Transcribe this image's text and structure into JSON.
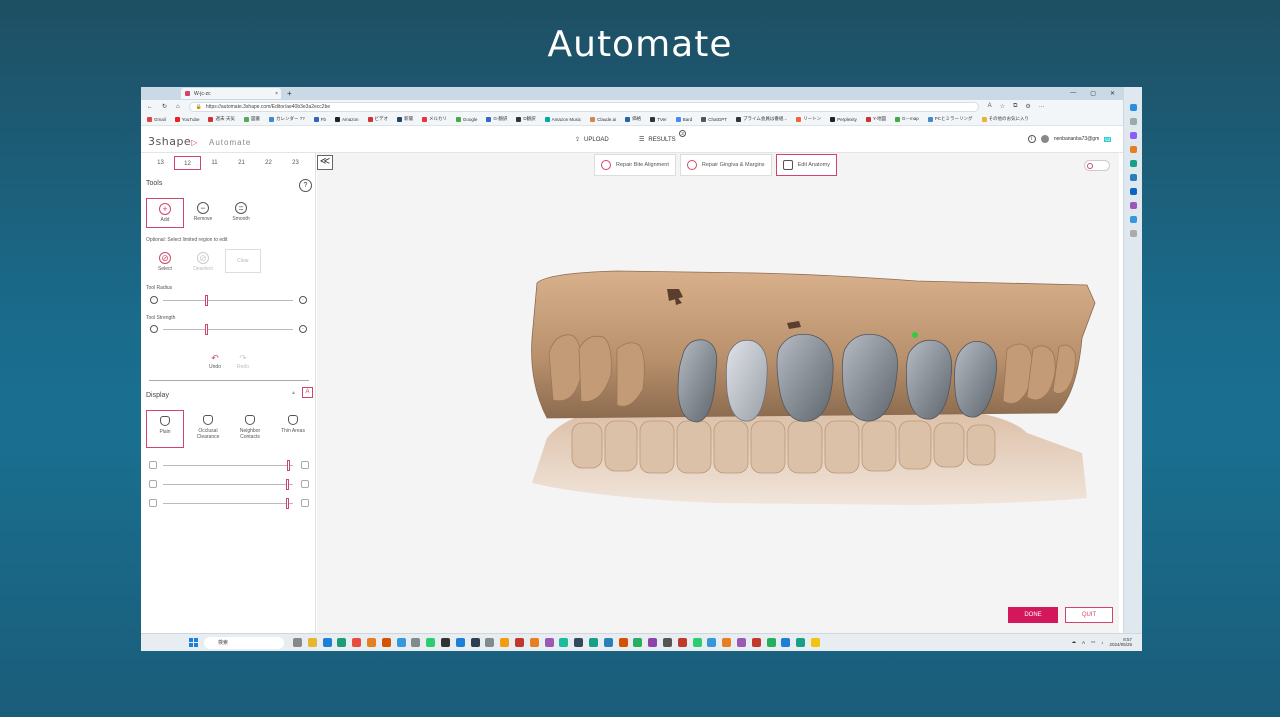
{
  "slide": {
    "title": "Automate"
  },
  "browser": {
    "tab_title": "W-jc-zc",
    "tab_close": "×",
    "new_tab": "+",
    "url": "https://automate.3shape.com/Editor/ae40b3e3a2ecc2be",
    "window_buttons": [
      "—",
      "▢",
      "✕"
    ],
    "nav": [
      "←",
      "↻",
      "⌂"
    ],
    "bookmarks": [
      "Gmail",
      "YouTube",
      "週末·天気",
      "図書",
      "カレンダー ??",
      "Fb",
      "Amazon",
      "ビデオ",
      "新聞",
      "メルカリ",
      "Google",
      "G-翻訳",
      "D翻訳",
      "Amazon Music",
      "Claude.ai",
      "価格",
      "TVer",
      "Bard",
      "ChatGPT",
      "プライム会員は番組...",
      "リートン",
      "Perplexity",
      "Y-地図",
      "G－map",
      "PCとミラーリング"
    ],
    "bookmarks_more": "その他のお気に入り"
  },
  "app": {
    "logo": "3shape",
    "logo_mark": "▷",
    "product": "Automate",
    "upload": "UPLOAD",
    "results": "RESULTS",
    "results_count": "3",
    "user": "nenbananba73@gm",
    "user_badge": "tid",
    "info_icon": "i"
  },
  "teeth_tabs": [
    "13",
    "12",
    "11",
    "21",
    "22",
    "23"
  ],
  "active_tooth": "12",
  "tools": {
    "title": "Tools",
    "help": "?",
    "items": [
      {
        "label": "Add",
        "glyph": "+"
      },
      {
        "label": "Remove",
        "glyph": "−"
      },
      {
        "label": "Smooth",
        "glyph": "="
      }
    ],
    "optional": "Optional: Select limited region to edit",
    "region": [
      {
        "label": "Select",
        "glyph": "⊘"
      },
      {
        "label": "Deselect",
        "glyph": "⊘"
      },
      {
        "label": "Clear",
        "glyph": "⊘"
      }
    ],
    "radius_label": "Tool Radius",
    "radius_value": 0.33,
    "strength_label": "Tool Strength",
    "strength_value": 0.33,
    "undo": "Undo",
    "redo": "Redo"
  },
  "display": {
    "title": "Display",
    "collapse_glyph": "▲",
    "a_glyph": "A",
    "modes": [
      {
        "label": "Plain"
      },
      {
        "label": "Occlusal Clearance"
      },
      {
        "label": "Neighbor Contacts"
      },
      {
        "label": "Thin Areas"
      }
    ],
    "opacity_values": [
      0.98,
      0.97,
      0.97
    ]
  },
  "steps": [
    {
      "label": "Repair Bite Alignment"
    },
    {
      "label": "Repair Gingiva & Margins"
    },
    {
      "label": "Edit Anatomy"
    }
  ],
  "collapse_panel": "≪",
  "actions": {
    "done": "DONE",
    "quit": "QUIT"
  },
  "taskbar": {
    "search": "検索",
    "time": "8:57",
    "date": "2024/05/25",
    "lang": "A"
  },
  "colors": {
    "accent": "#d2185b",
    "gum": "#c9a07e",
    "restoration": "#8e949c"
  }
}
